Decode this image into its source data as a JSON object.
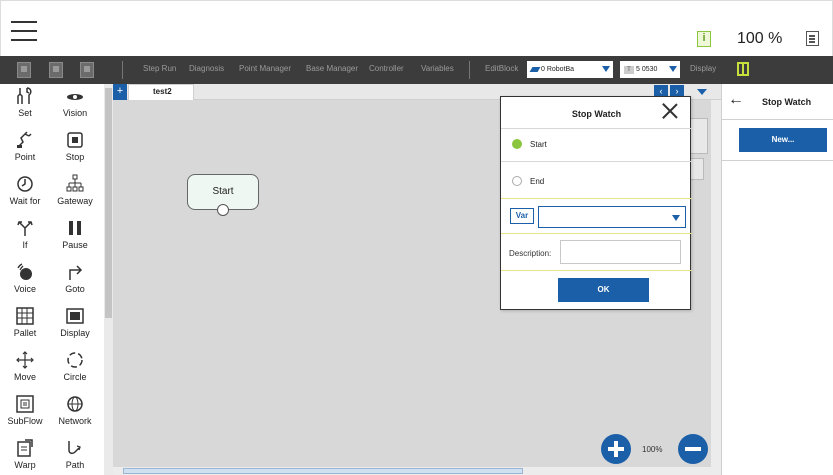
{
  "header": {
    "zoom_label": "100 %",
    "info_icon_letter": "i"
  },
  "toolbar": {
    "items": [
      "Step Run",
      "Diagnosis",
      "Point Manager",
      "Base Manager",
      "Controller",
      "Variables"
    ],
    "editblock": "EditBlock",
    "robot_select": "0 RobotBa",
    "tool_select": "5 0530",
    "tool_badge": "T",
    "display": "Display"
  },
  "palette": {
    "items": [
      {
        "label": "Set",
        "icon": "set-icon"
      },
      {
        "label": "Vision",
        "icon": "vision-icon"
      },
      {
        "label": "Point",
        "icon": "point-icon"
      },
      {
        "label": "Stop",
        "icon": "stop-icon"
      },
      {
        "label": "Wait for",
        "icon": "wait-for-icon"
      },
      {
        "label": "Gateway",
        "icon": "gateway-icon"
      },
      {
        "label": "If",
        "icon": "if-icon"
      },
      {
        "label": "Pause",
        "icon": "pause-icon"
      },
      {
        "label": "Voice",
        "icon": "voice-icon"
      },
      {
        "label": "Goto",
        "icon": "goto-icon"
      },
      {
        "label": "Pallet",
        "icon": "pallet-icon"
      },
      {
        "label": "Display",
        "icon": "display-icon"
      },
      {
        "label": "Move",
        "icon": "move-icon"
      },
      {
        "label": "Circle",
        "icon": "circle-icon"
      },
      {
        "label": "SubFlow",
        "icon": "subflow-icon"
      },
      {
        "label": "Network",
        "icon": "network-icon"
      },
      {
        "label": "Warp",
        "icon": "warp-icon"
      },
      {
        "label": "Path",
        "icon": "path-icon"
      }
    ]
  },
  "canvas": {
    "tab_add": "+",
    "tab_label": "test2",
    "nav_prev": "‹",
    "nav_next": "›",
    "start_node": "Start",
    "zoom": "100%"
  },
  "right_panel": {
    "back": "←",
    "title": "Stop Watch",
    "new_button": "New..."
  },
  "dialog": {
    "title": "Stop Watch",
    "options": [
      {
        "label": "Start",
        "checked": true
      },
      {
        "label": "End",
        "checked": false
      }
    ],
    "var_tag": "Var",
    "var_value": "",
    "description_label": "Description:",
    "description_value": "",
    "ok": "OK"
  },
  "colors": {
    "accent": "#1b5fa8",
    "toolbar_bg": "#3c3c3c",
    "canvas_bg": "#d8d8d8",
    "radio_checked": "#8cc63f"
  }
}
